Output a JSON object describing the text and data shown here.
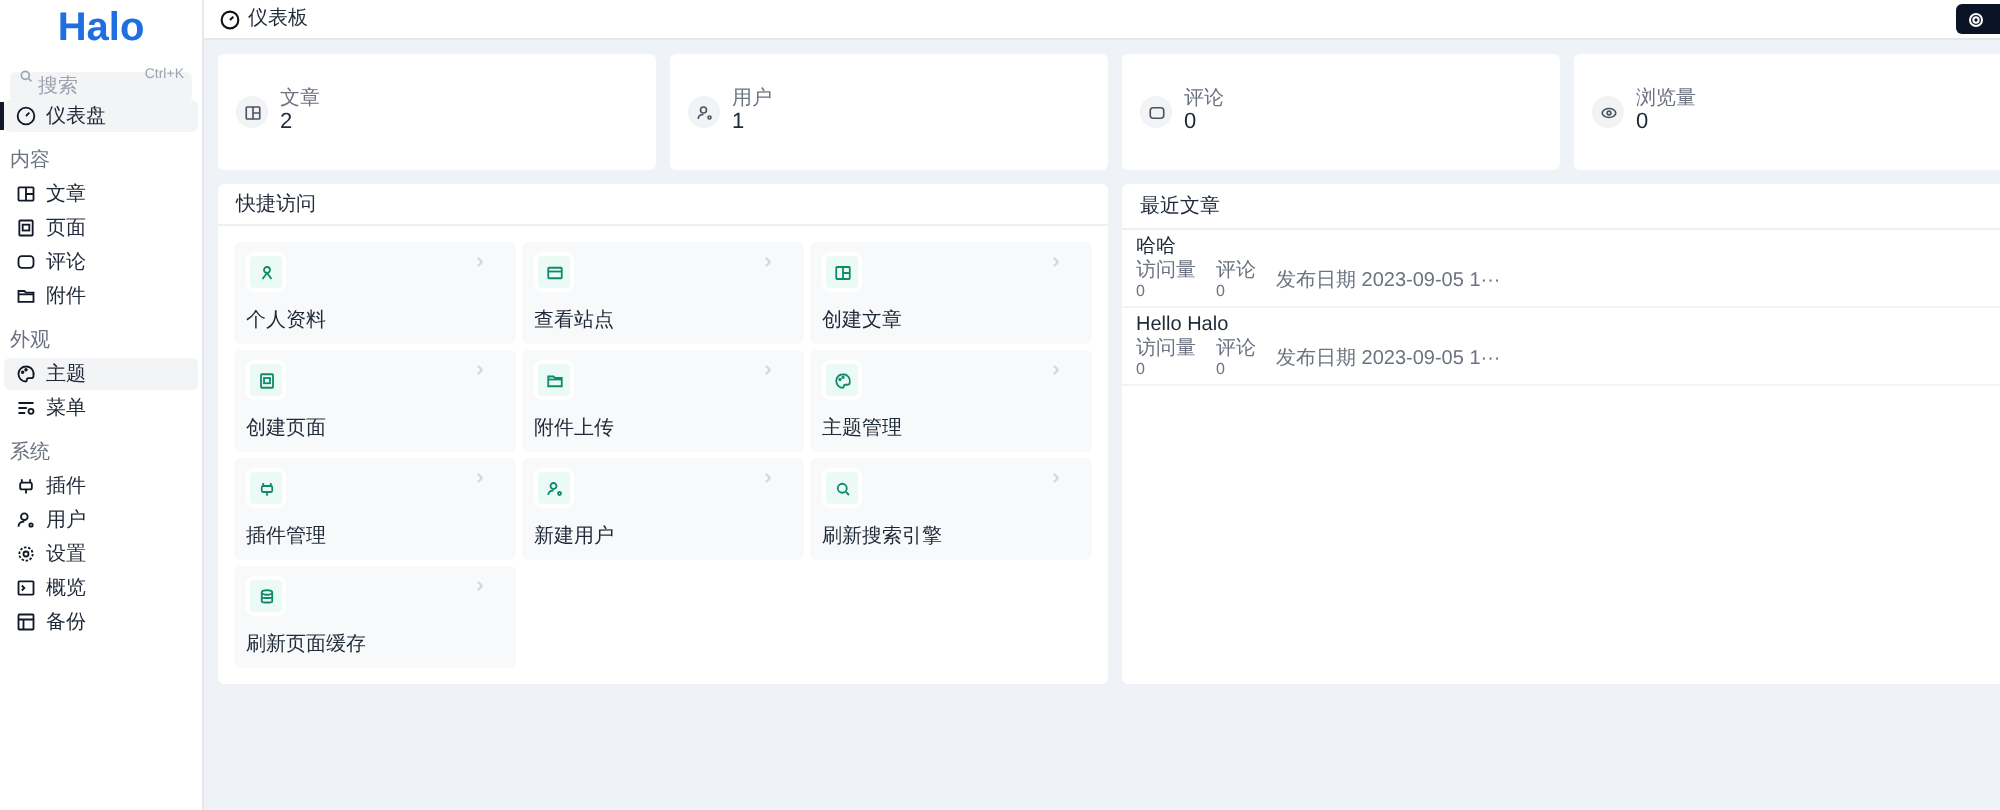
{
  "sidebar": {
    "logo": "Halo",
    "search": {
      "placeholder": "搜索",
      "shortcut": "Ctrl+K"
    },
    "groups": [
      {
        "items": [
          {
            "label": "仪表盘",
            "selected": true,
            "highlighted": true
          }
        ]
      },
      {
        "title": "内容",
        "items": [
          {
            "label": "文章",
            "selected": false,
            "highlighted": false
          },
          {
            "label": "页面",
            "selected": false,
            "highlighted": false
          },
          {
            "label": "评论",
            "selected": false,
            "highlighted": false
          },
          {
            "label": "附件",
            "selected": false,
            "highlighted": false
          }
        ]
      },
      {
        "title": "外观",
        "items": [
          {
            "label": "主题",
            "selected": false,
            "highlighted": true
          },
          {
            "label": "菜单",
            "selected": false,
            "highlighted": false
          }
        ]
      },
      {
        "title": "系统",
        "items": [
          {
            "label": "插件",
            "selected": false,
            "highlighted": false
          },
          {
            "label": "用户",
            "selected": false,
            "highlighted": false
          },
          {
            "label": "设置",
            "selected": false,
            "highlighted": false
          },
          {
            "label": "概览",
            "selected": false,
            "highlighted": false
          },
          {
            "label": "备份",
            "selected": false,
            "highlighted": false
          }
        ]
      }
    ]
  },
  "header": {
    "title": "仪表板"
  },
  "stats": [
    {
      "label": "文章",
      "value": "2"
    },
    {
      "label": "用户",
      "value": "1"
    },
    {
      "label": "评论",
      "value": "0"
    },
    {
      "label": "浏览量",
      "value": "0"
    }
  ],
  "quick_access": {
    "title": "快捷访问",
    "items": [
      "个人资料",
      "查看站点",
      "创建文章",
      "创建页面",
      "附件上传",
      "主题管理",
      "插件管理",
      "新建用户",
      "刷新搜索引擎",
      "刷新页面缓存"
    ]
  },
  "recent_posts": {
    "title": "最近文章",
    "posts": [
      {
        "title": "哈哈",
        "visits_label": "访问量",
        "visits": "0",
        "comments_label": "评论",
        "comments": "0",
        "date": "发布日期 2023-09-05 1···"
      },
      {
        "title": "Hello Halo",
        "visits_label": "访问量",
        "visits": "0",
        "comments_label": "评论",
        "comments": "0",
        "date": "发布日期 2023-09-05 1···"
      }
    ]
  }
}
